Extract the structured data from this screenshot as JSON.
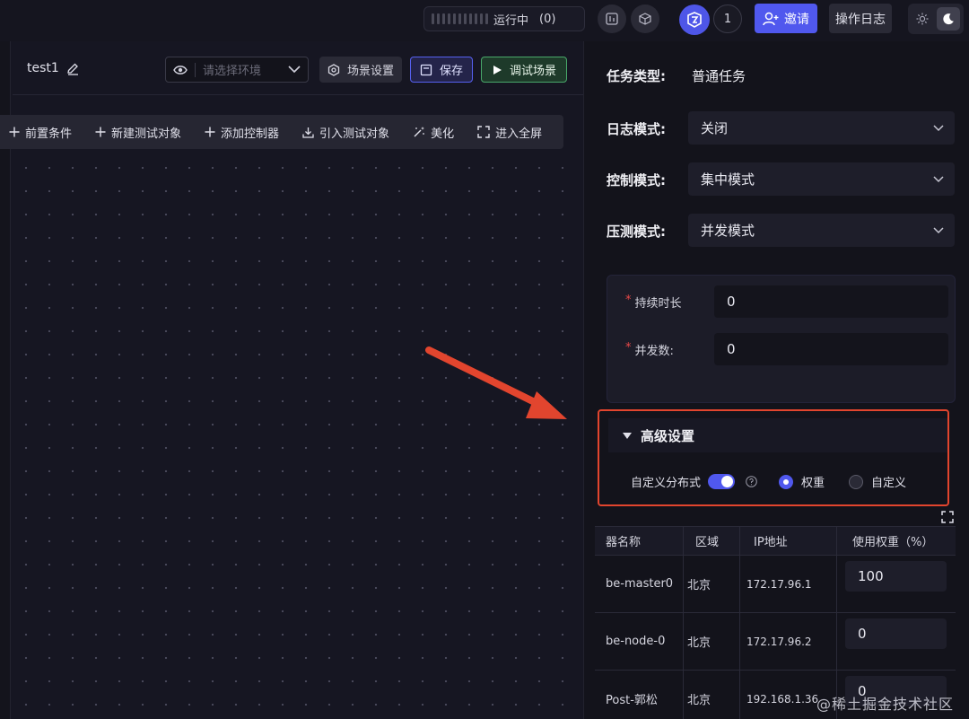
{
  "topbar": {
    "run_status_label": "运行中",
    "run_status_count": "(0)",
    "notification_count": "1",
    "invite_label": "邀请",
    "operation_log_label": "操作日志"
  },
  "scene": {
    "name": "test1",
    "env_placeholder": "请选择环境",
    "settings_label": "场景设置",
    "save_label": "保存",
    "debug_label": "调试场景"
  },
  "toolbar": {
    "items": [
      {
        "label": "前置条件",
        "icon": "plus-icon"
      },
      {
        "label": "新建测试对象",
        "icon": "plus-icon"
      },
      {
        "label": "添加控制器",
        "icon": "plus-icon"
      },
      {
        "label": "引入测试对象",
        "icon": "import-icon"
      },
      {
        "label": "美化",
        "icon": "magic-wand-icon"
      },
      {
        "label": "进入全屏",
        "icon": "fullscreen-icon"
      }
    ]
  },
  "panel": {
    "task_type_label": "任务类型:",
    "task_type_value": "普通任务",
    "log_mode_label": "日志模式:",
    "log_mode_value": "关闭",
    "control_mode_label": "控制模式:",
    "control_mode_value": "集中模式",
    "pressure_mode_label": "压测模式:",
    "pressure_mode_value": "并发模式",
    "duration_label": "持续时长",
    "duration_value": "0",
    "concurrency_label": "并发数:",
    "concurrency_value": "0",
    "required_mark": "*"
  },
  "advanced": {
    "title": "高级设置",
    "custom_distribution_label": "自定义分布式",
    "custom_distribution_on": true,
    "radio_weight_label": "权重",
    "radio_custom_label": "自定义",
    "selected": "权重"
  },
  "machine_table": {
    "headers": [
      "器名称",
      "区域",
      "IP地址",
      "使用权重（%）"
    ],
    "rows": [
      {
        "name": "be-master0",
        "region": "北京",
        "ip": "172.17.96.1",
        "weight": "100"
      },
      {
        "name": "be-node-0",
        "region": "北京",
        "ip": "172.17.96.2",
        "weight": "0"
      },
      {
        "name": "Post-郭松",
        "region": "北京",
        "ip": "192.168.1.36",
        "weight": "0"
      }
    ]
  },
  "watermark": "@稀土掘金技术社区",
  "colors": {
    "accent": "#5058ee",
    "highlight_border": "#e2452e",
    "debug_green": "#49a86a",
    "required_red": "#e84848"
  }
}
